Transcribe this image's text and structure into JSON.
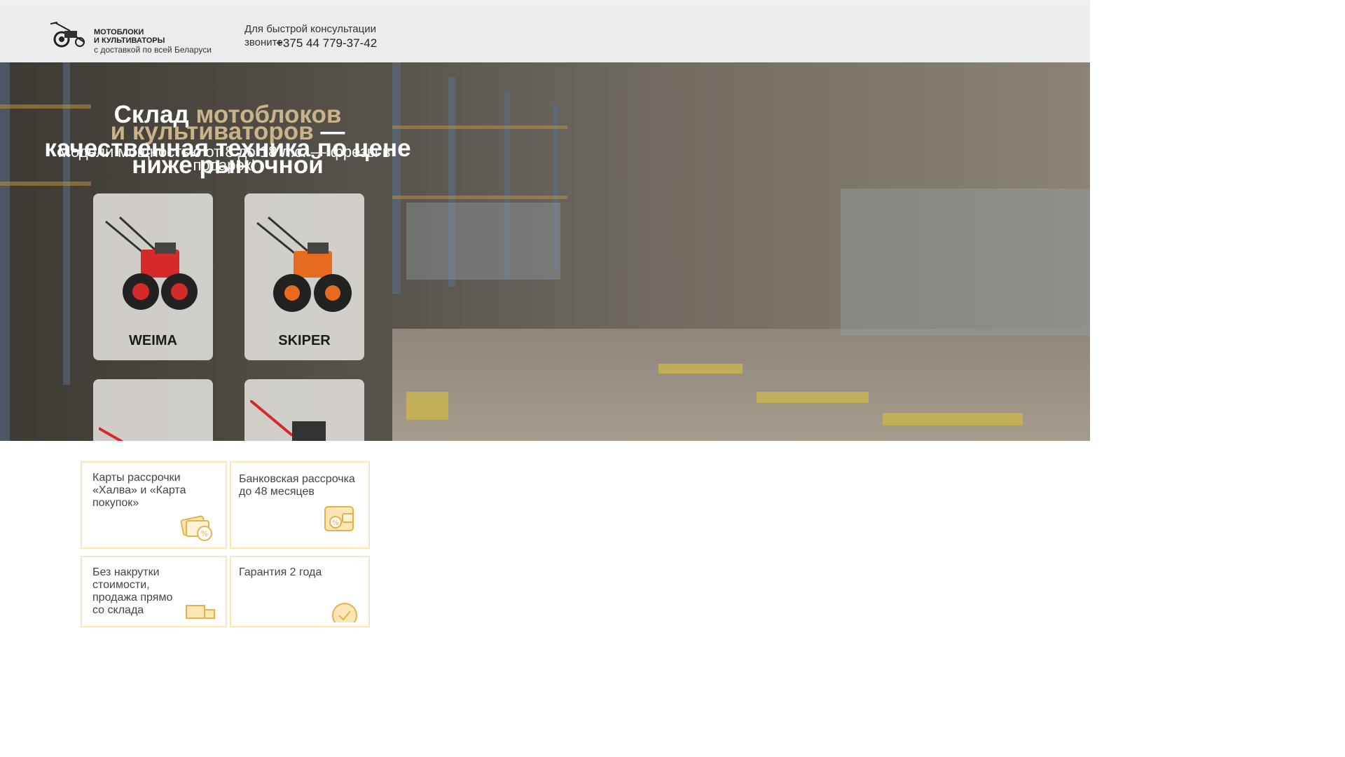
{
  "header": {
    "logo_line1": "МОТОБЛОКИ",
    "logo_line2": "И КУЛЬТИВАТОРЫ",
    "logo_tagline": "с доставкой по всей Беларуси",
    "consult_text": "Для быстрой консультации звоните:",
    "phone": "+375 44 779-37-42"
  },
  "hero": {
    "title_part1": "Склад ",
    "title_accent1": "мотоблоков",
    "title_accent2": "и культиваторов",
    "title_part2": " —",
    "title_line3": "качественная техника по цене",
    "title_line4": "ниже рыночной",
    "subtitle": "Модели мощностью от 8 до 18 л.с. — фрезы в подарок!"
  },
  "brands": [
    {
      "label": "WEIMA",
      "color": "#d42a2a"
    },
    {
      "label": "SKIPER",
      "color": "#e86a1e"
    },
    {
      "label": "",
      "color": "#d42a2a"
    },
    {
      "label": "",
      "color": "#d42a2a"
    }
  ],
  "benefits": [
    {
      "text": "Карты рассрочки «Халва» и «Карта покупок»",
      "icon": "credit-cards-icon"
    },
    {
      "text": "Банковская рассрочка до 48 месяцев",
      "icon": "wallet-percent-icon"
    },
    {
      "text": "Без накрутки стоимости, продажа прямо со склада",
      "icon": "truck-icon"
    },
    {
      "text": "Гарантия 2 года",
      "icon": "warranty-badge-icon"
    }
  ],
  "colors": {
    "accent": "#e8b04a",
    "header_bg": "#ececec"
  }
}
